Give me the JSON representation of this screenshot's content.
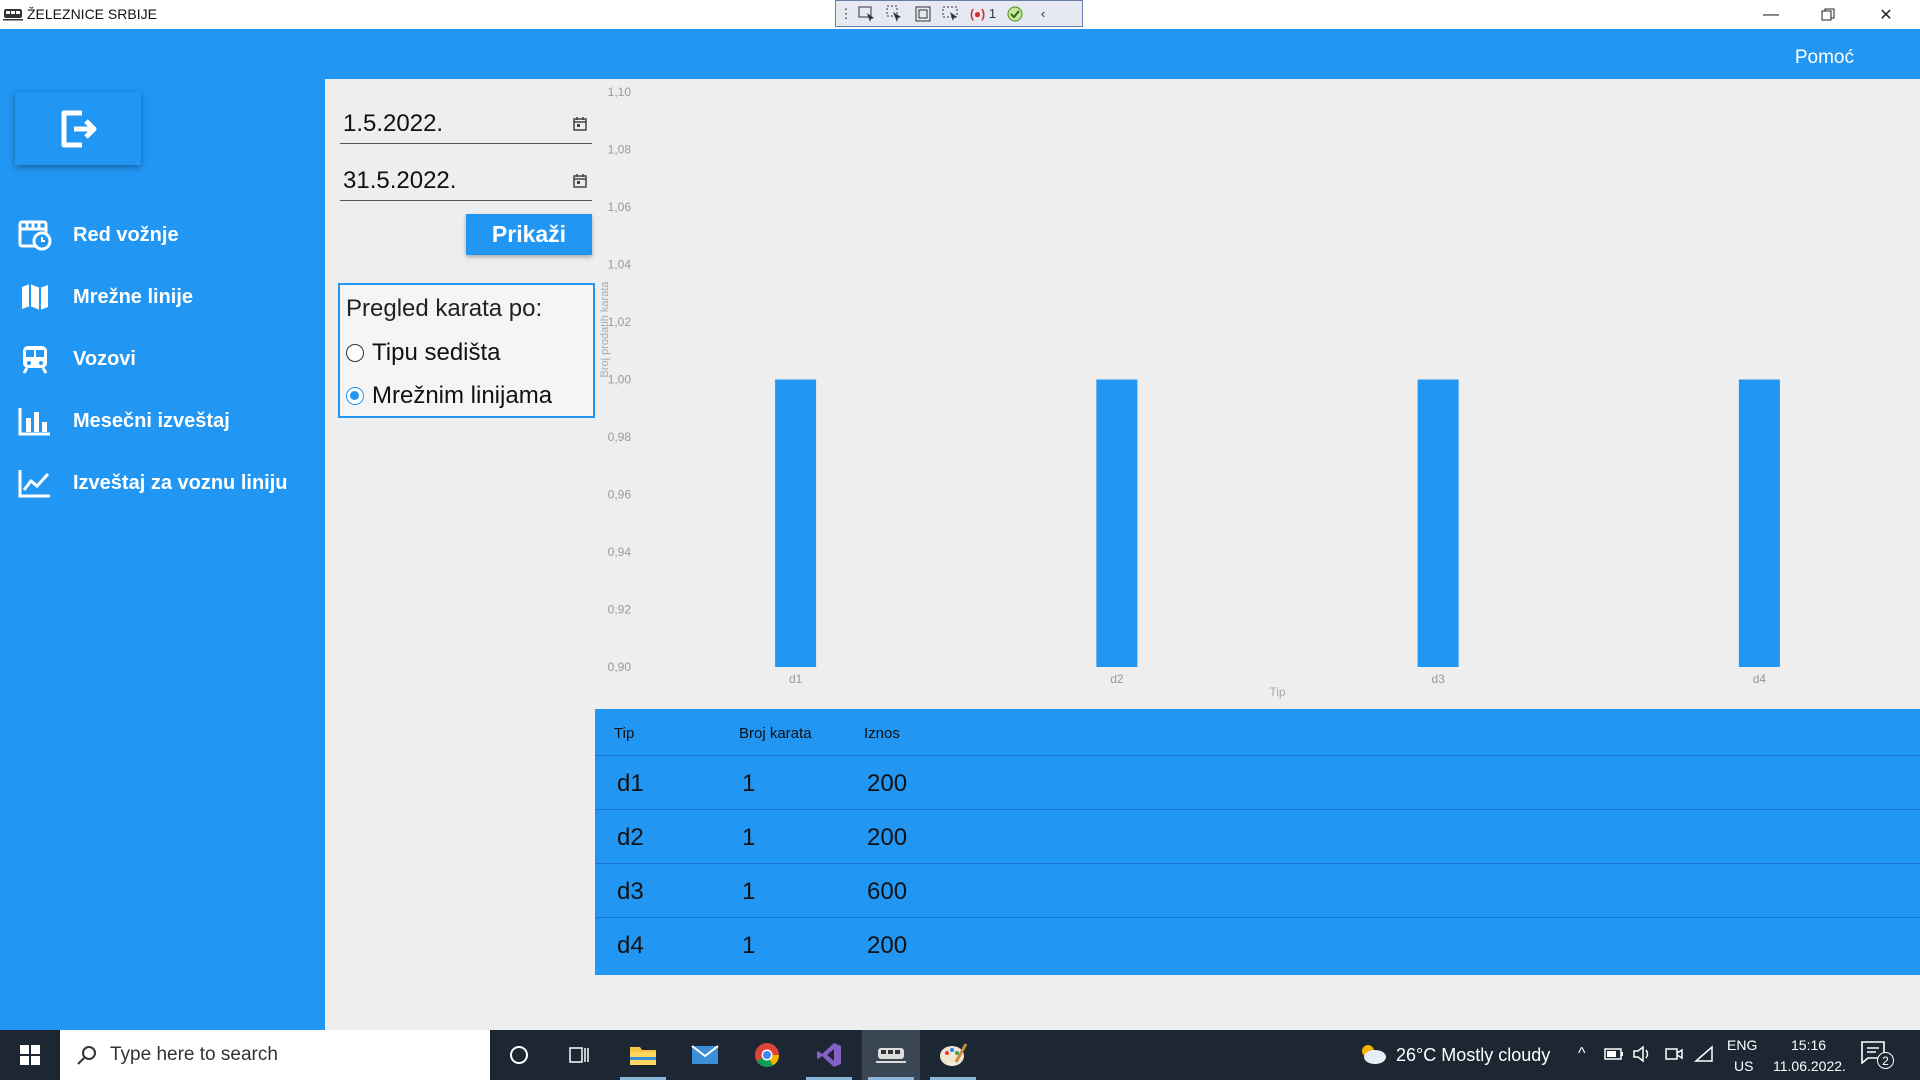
{
  "window": {
    "title": "ŽELEZNICE SRBIJE",
    "debug_count": "1"
  },
  "header": {
    "help_label": "Pomoć"
  },
  "sidebar": {
    "items": [
      {
        "label": "Red vožnje",
        "icon": "schedule-icon"
      },
      {
        "label": "Mrežne linije",
        "icon": "map-icon"
      },
      {
        "label": "Vozovi",
        "icon": "train-icon"
      },
      {
        "label": "Mesečni izveštaj",
        "icon": "bar-chart-icon"
      },
      {
        "label": "Izveštaj za voznu liniju",
        "icon": "line-chart-icon"
      }
    ]
  },
  "filters": {
    "date_from": "1.5.2022.",
    "date_to": "31.5.2022.",
    "show_button": "Prikaži",
    "group_title": "Pregled karata po:",
    "options": [
      {
        "label": "Tipu sedišta",
        "checked": false
      },
      {
        "label": "Mrežnim linijama",
        "checked": true
      }
    ]
  },
  "chart_data": {
    "type": "bar",
    "categories": [
      "d1",
      "d2",
      "d3",
      "d4"
    ],
    "values": [
      1,
      1,
      1,
      1
    ],
    "xlabel": "Tip",
    "ylabel": "Broj prodatih karata",
    "ylim": [
      0.9,
      1.1
    ],
    "y_ticks": [
      "0,90",
      "0,92",
      "0,94",
      "0,96",
      "0,98",
      "1,00",
      "1,02",
      "1,04",
      "1,06",
      "1,08",
      "1,10"
    ],
    "bar_color": "#2196f3",
    "grid": false,
    "legend": "none"
  },
  "table": {
    "columns": [
      "Tip",
      "Broj karata",
      "Iznos"
    ],
    "rows": [
      [
        "d1",
        "1",
        "200"
      ],
      [
        "d2",
        "1",
        "200"
      ],
      [
        "d3",
        "1",
        "600"
      ],
      [
        "d4",
        "1",
        "200"
      ]
    ]
  },
  "taskbar": {
    "search_placeholder": "Type here to search",
    "weather": "26°C  Mostly cloudy",
    "lang_top": "ENG",
    "lang_bottom": "US",
    "time": "15:16",
    "date": "11.06.2022.",
    "notifications": "2"
  },
  "colors": {
    "accent": "#2196f3",
    "content_bg": "#eeeeee",
    "taskbar": "#1c2733"
  }
}
